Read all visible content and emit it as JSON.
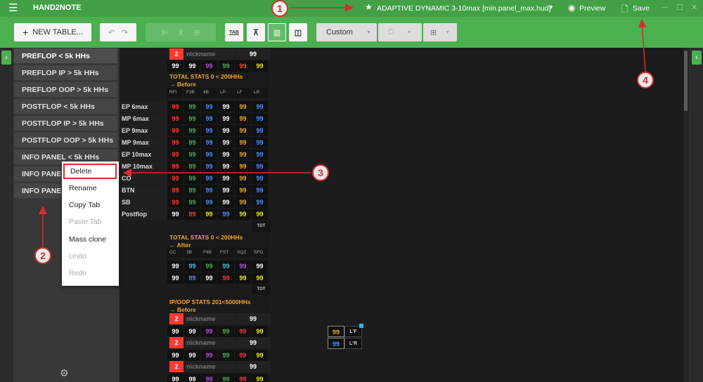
{
  "titlebar": {
    "app_name": "HAND2NOTE",
    "hud_name": "ADAPTIVE DYNAMIC 3-10max [min.panel_max.hud]",
    "preview_label": "Preview",
    "save_label": "Save"
  },
  "toolbar": {
    "new_table_label": "NEW TABLE...",
    "custom_label": "Custom",
    "tab_icon_label": "TAB"
  },
  "sidebar": {
    "tabs": [
      "PREFLOP < 5k HHs",
      "PREFLOP IP > 5k HHs",
      "PREFLOP OOP > 5k HHs",
      "POSTFLOP < 5k HHs",
      "POSTFLOP IP > 5k HHs",
      "POSTFLOP OOP > 5k HHs",
      "INFO PANEL < 5k HHs",
      "INFO PANEL",
      "INFO PANEL"
    ]
  },
  "context_menu": {
    "items": [
      "Delete",
      "Rename",
      "Copy Tab",
      "Paste Tab",
      "Mass clone",
      "Undo",
      "Redo"
    ]
  },
  "annotations": [
    "1",
    "2",
    "3",
    "4"
  ],
  "hud": {
    "player_panel": {
      "seat": "2",
      "nickname": "nickname",
      "hands": "99",
      "stats": [
        "99",
        "99",
        "99",
        "99",
        "99",
        "99"
      ]
    },
    "section1": {
      "title": "TOTAL STATS 0 < 200HHs",
      "subtitle": "→ Before",
      "headers": [
        "RFI",
        "F3B",
        "4B",
        "LP",
        "LF",
        "LR"
      ],
      "rows": [
        "EP 6max",
        "MP 6max",
        "EP 9max",
        "MP 9max",
        "EP 10max",
        "MP 10max",
        "CO",
        "BTN",
        "SB",
        "Postflop"
      ],
      "value": "99",
      "footer": "TOT"
    },
    "section2": {
      "title": "TOTAL STATS 0 < 200HHs",
      "subtitle": "← After",
      "headers": [
        "CC",
        "3B",
        "F4B",
        "FST",
        "SQZ",
        "SFO"
      ],
      "value": "99",
      "footer": "TOT"
    },
    "section3": {
      "title": "IP/OOP  STATS 201<5000HHs",
      "subtitle": "→ Before"
    },
    "mini": {
      "v1": "99",
      "l1": "L'F",
      "v2": "99",
      "l2": "L'R"
    }
  },
  "colors": {
    "titlebar": "#43a047",
    "toolbar": "#4caf50",
    "red": "#ff3b30",
    "green": "#4caf50",
    "blue": "#4f8ef7",
    "purple": "#b44fe0",
    "yellow": "#e8e82a",
    "orange": "#f2a52b",
    "annotation": "#d32f2f"
  }
}
